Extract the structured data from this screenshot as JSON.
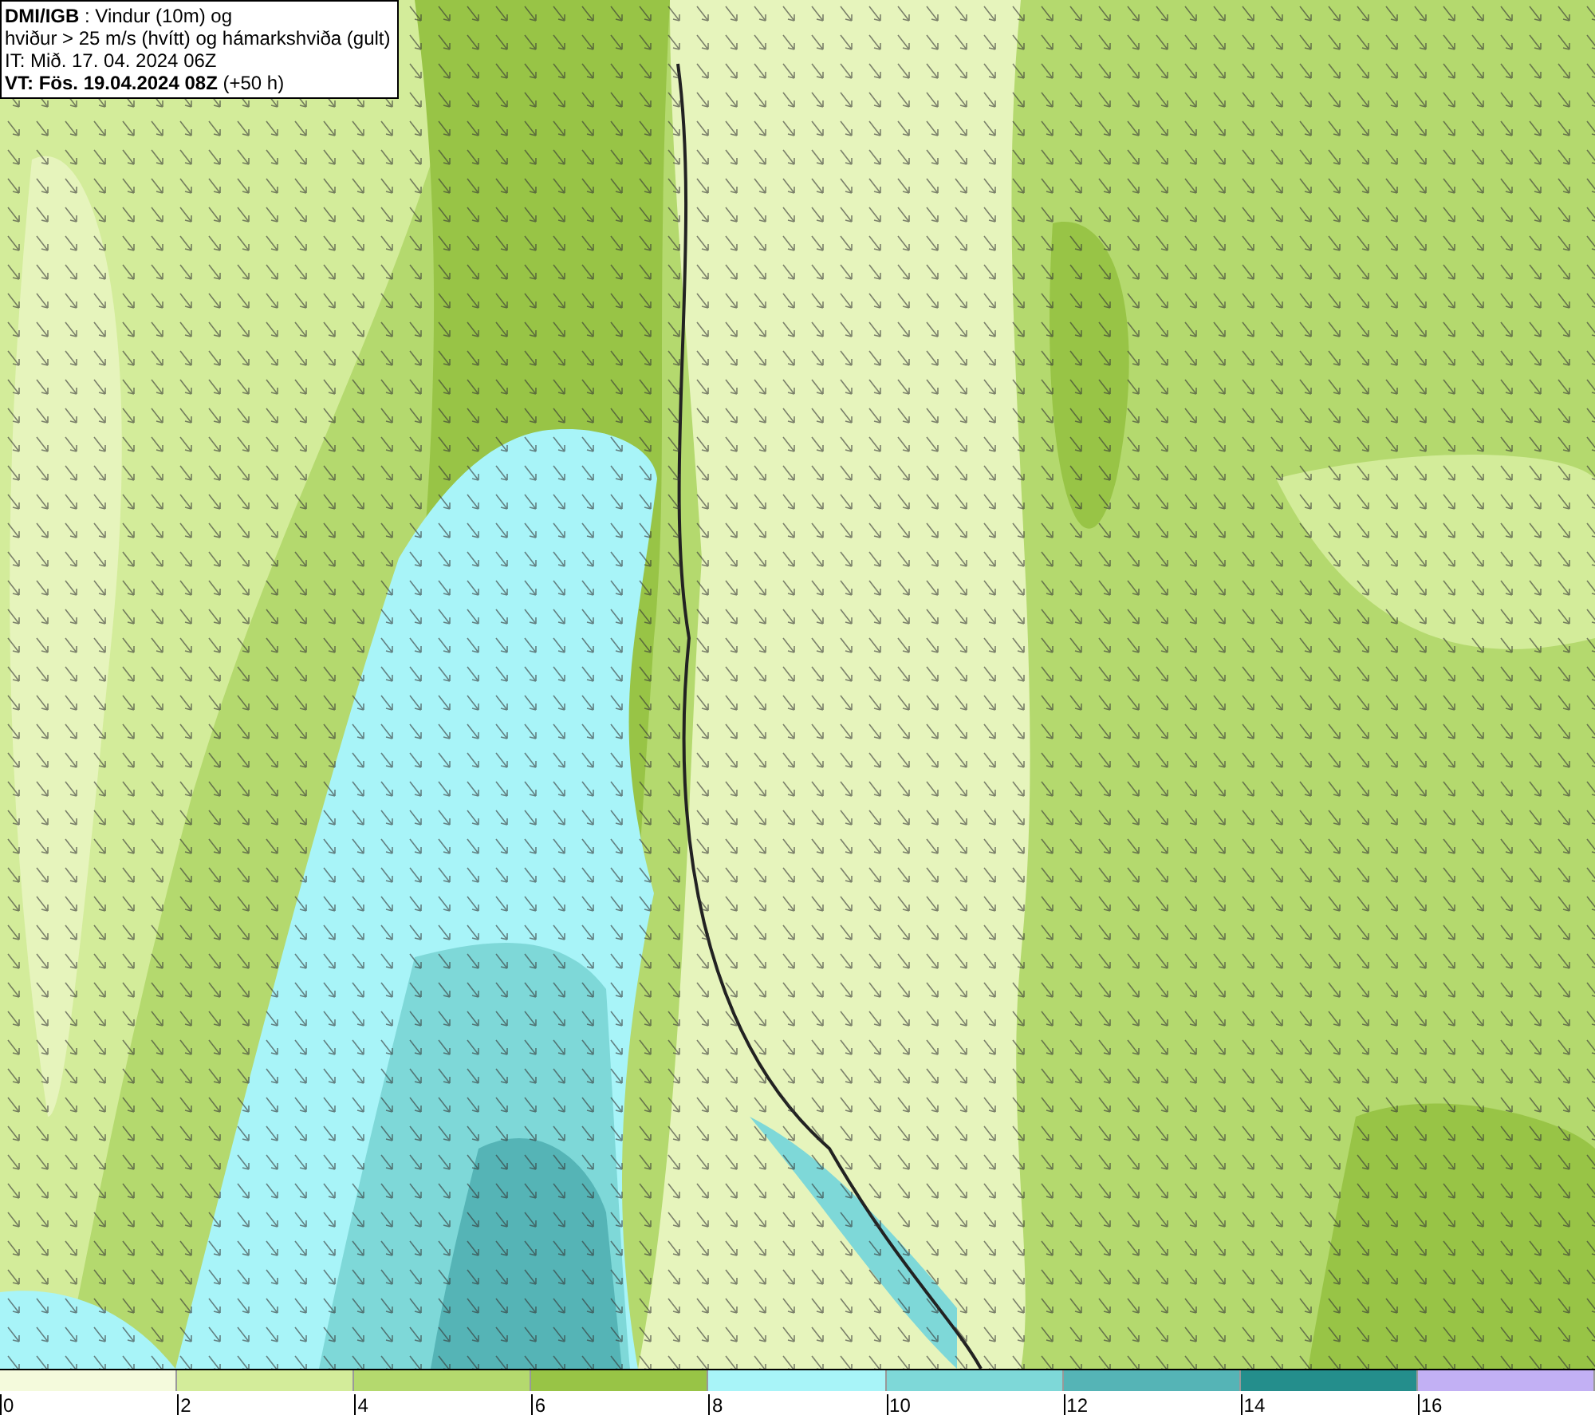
{
  "info_box": {
    "lines": [
      "**DMI/IGB** : Vindur (10m) og",
      "hviður > 25 m/s (hvítt) og hámarkshviða (gult)",
      "IT: Mið. 17. 04. 2024 06Z",
      "**VT: Fös. 19.04.2024 08Z** (+50 h)"
    ]
  },
  "legend": [
    {
      "label": "0",
      "color": "#f4fadc"
    },
    {
      "label": "2",
      "color": "#d3ec9a"
    },
    {
      "label": "4",
      "color": "#b4d96e"
    },
    {
      "label": "6",
      "color": "#98c446"
    },
    {
      "label": "8",
      "color": "#a8f4f8"
    },
    {
      "label": "10",
      "color": "#7ed8d8"
    },
    {
      "label": "12",
      "color": "#55b4b6"
    },
    {
      "label": "14",
      "color": "#248e8c"
    },
    {
      "label": "16",
      "color": "#c2b0f4"
    }
  ]
}
